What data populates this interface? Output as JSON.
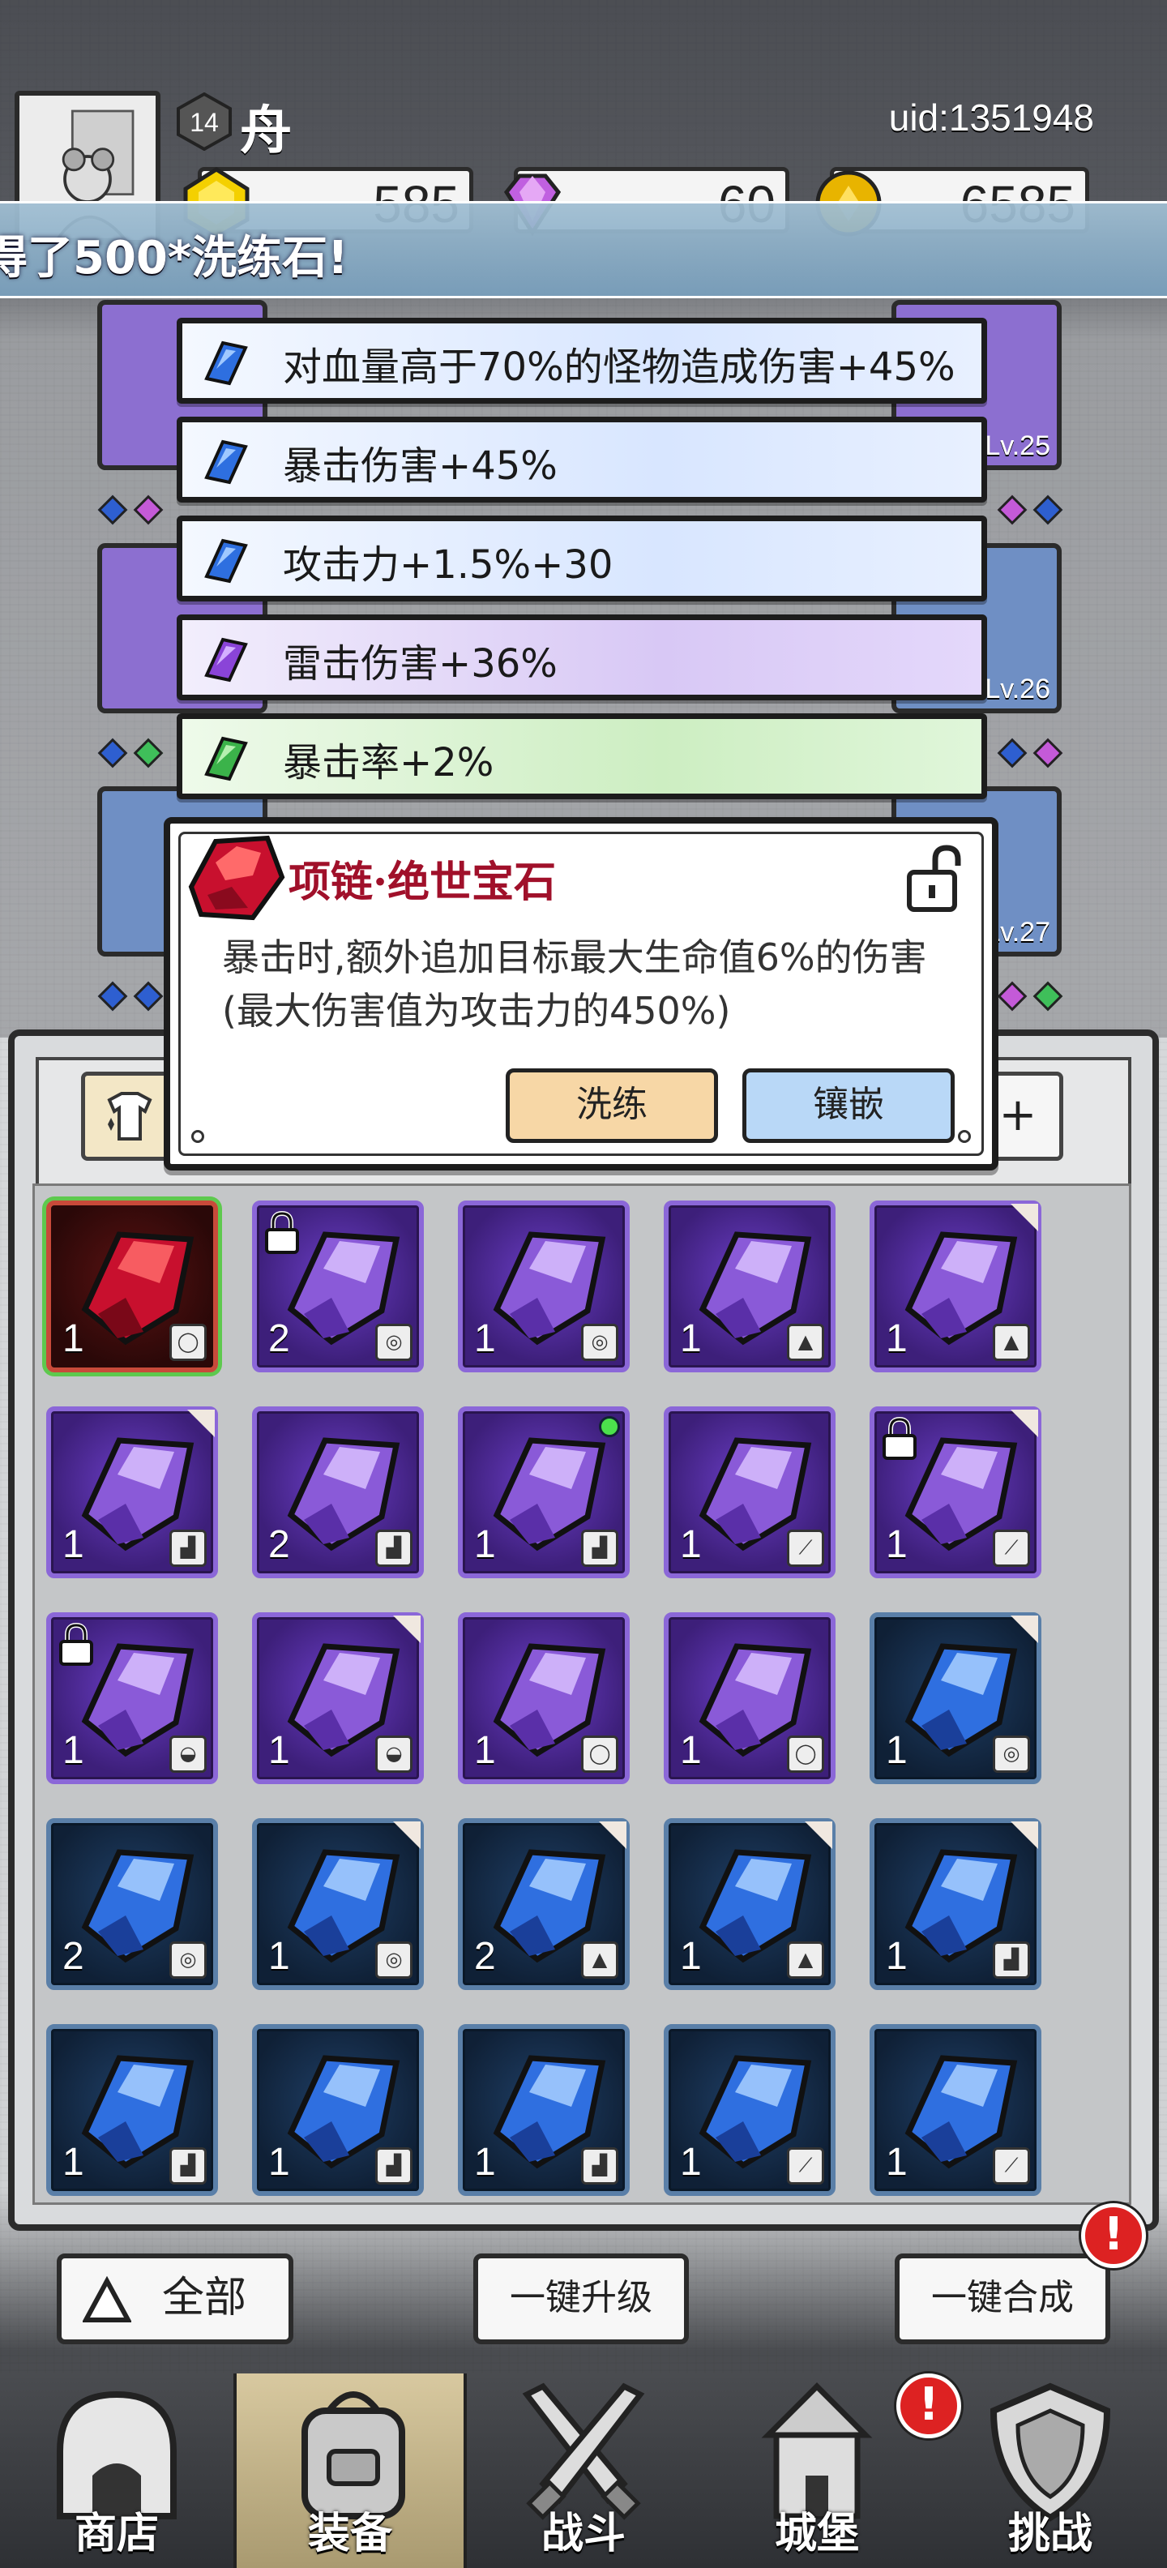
{
  "player": {
    "level": "14",
    "name": "舟",
    "uid": "uid:1351948"
  },
  "currencies": [
    {
      "name": "gold-gem",
      "value": "585",
      "color": "#f4d000"
    },
    {
      "name": "diamond",
      "value": "60",
      "color": "#c060e0"
    },
    {
      "name": "coin",
      "value": "6585",
      "color": "#e8b400"
    }
  ],
  "toast": "得了500*洗练石!",
  "equipment_levels": {
    "slot_1": "Lv.25",
    "slot_2": "Lv.26",
    "slot_3": "Lv.27"
  },
  "affixes": [
    {
      "text": "对血量高于70%的怪物造成伤害+45%",
      "rarity": "blue"
    },
    {
      "text": "暴击伤害+45%",
      "rarity": "blue"
    },
    {
      "text": "攻击力+1.5%+30",
      "rarity": "blue"
    },
    {
      "text": "雷击伤害+36%",
      "rarity": "purple"
    },
    {
      "text": "暴击率+2%",
      "rarity": "green"
    }
  ],
  "detail": {
    "title": "项链·绝世宝石",
    "description": "暴击时,额外追加目标最大生命值6%的伤害(最大伤害值为攻击力的450%)",
    "refine_label": "洗练",
    "inlay_label": "镶嵌"
  },
  "inventory_tabs": {
    "plus": "+"
  },
  "inventory": [
    {
      "rarity": "red",
      "qty": "1",
      "slot": "necklace",
      "selected": true
    },
    {
      "rarity": "purple",
      "qty": "2",
      "slot": "ring",
      "locked": true
    },
    {
      "rarity": "purple",
      "qty": "1",
      "slot": "ring"
    },
    {
      "rarity": "purple",
      "qty": "1",
      "slot": "armor"
    },
    {
      "rarity": "purple",
      "qty": "1",
      "slot": "armor",
      "corner": true
    },
    {
      "rarity": "purple",
      "qty": "1",
      "slot": "boots",
      "corner": true
    },
    {
      "rarity": "purple",
      "qty": "2",
      "slot": "boots"
    },
    {
      "rarity": "purple",
      "qty": "1",
      "slot": "boots",
      "new": true
    },
    {
      "rarity": "purple",
      "qty": "1",
      "slot": "weapon"
    },
    {
      "rarity": "purple",
      "qty": "1",
      "slot": "weapon",
      "locked": true,
      "corner": true
    },
    {
      "rarity": "purple",
      "qty": "1",
      "slot": "helmet",
      "locked": true
    },
    {
      "rarity": "purple",
      "qty": "1",
      "slot": "helmet",
      "corner": true
    },
    {
      "rarity": "purple",
      "qty": "1",
      "slot": "necklace"
    },
    {
      "rarity": "purple",
      "qty": "1",
      "slot": "necklace"
    },
    {
      "rarity": "blue",
      "qty": "1",
      "slot": "ring",
      "corner": true
    },
    {
      "rarity": "blue",
      "qty": "2",
      "slot": "ring"
    },
    {
      "rarity": "blue",
      "qty": "1",
      "slot": "ring",
      "corner": true
    },
    {
      "rarity": "blue",
      "qty": "2",
      "slot": "armor",
      "corner": true
    },
    {
      "rarity": "blue",
      "qty": "1",
      "slot": "armor",
      "corner": true
    },
    {
      "rarity": "blue",
      "qty": "1",
      "slot": "boots",
      "corner": true
    },
    {
      "rarity": "blue",
      "qty": "1",
      "slot": "boots"
    },
    {
      "rarity": "blue",
      "qty": "1",
      "slot": "boots"
    },
    {
      "rarity": "blue",
      "qty": "1",
      "slot": "boots"
    },
    {
      "rarity": "blue",
      "qty": "1",
      "slot": "weapon"
    },
    {
      "rarity": "blue",
      "qty": "1",
      "slot": "weapon"
    }
  ],
  "bottom_buttons": {
    "filter_label": "全部",
    "upgrade_label": "一键升级",
    "merge_label": "一键合成",
    "alert": "!"
  },
  "nav": [
    {
      "label": "商店",
      "icon": "shop-icon"
    },
    {
      "label": "装备",
      "icon": "backpack-icon",
      "active": true
    },
    {
      "label": "战斗",
      "icon": "crossed-swords-icon"
    },
    {
      "label": "城堡",
      "icon": "castle-icon",
      "alert": "!"
    },
    {
      "label": "挑战",
      "icon": "shield-icon"
    }
  ]
}
